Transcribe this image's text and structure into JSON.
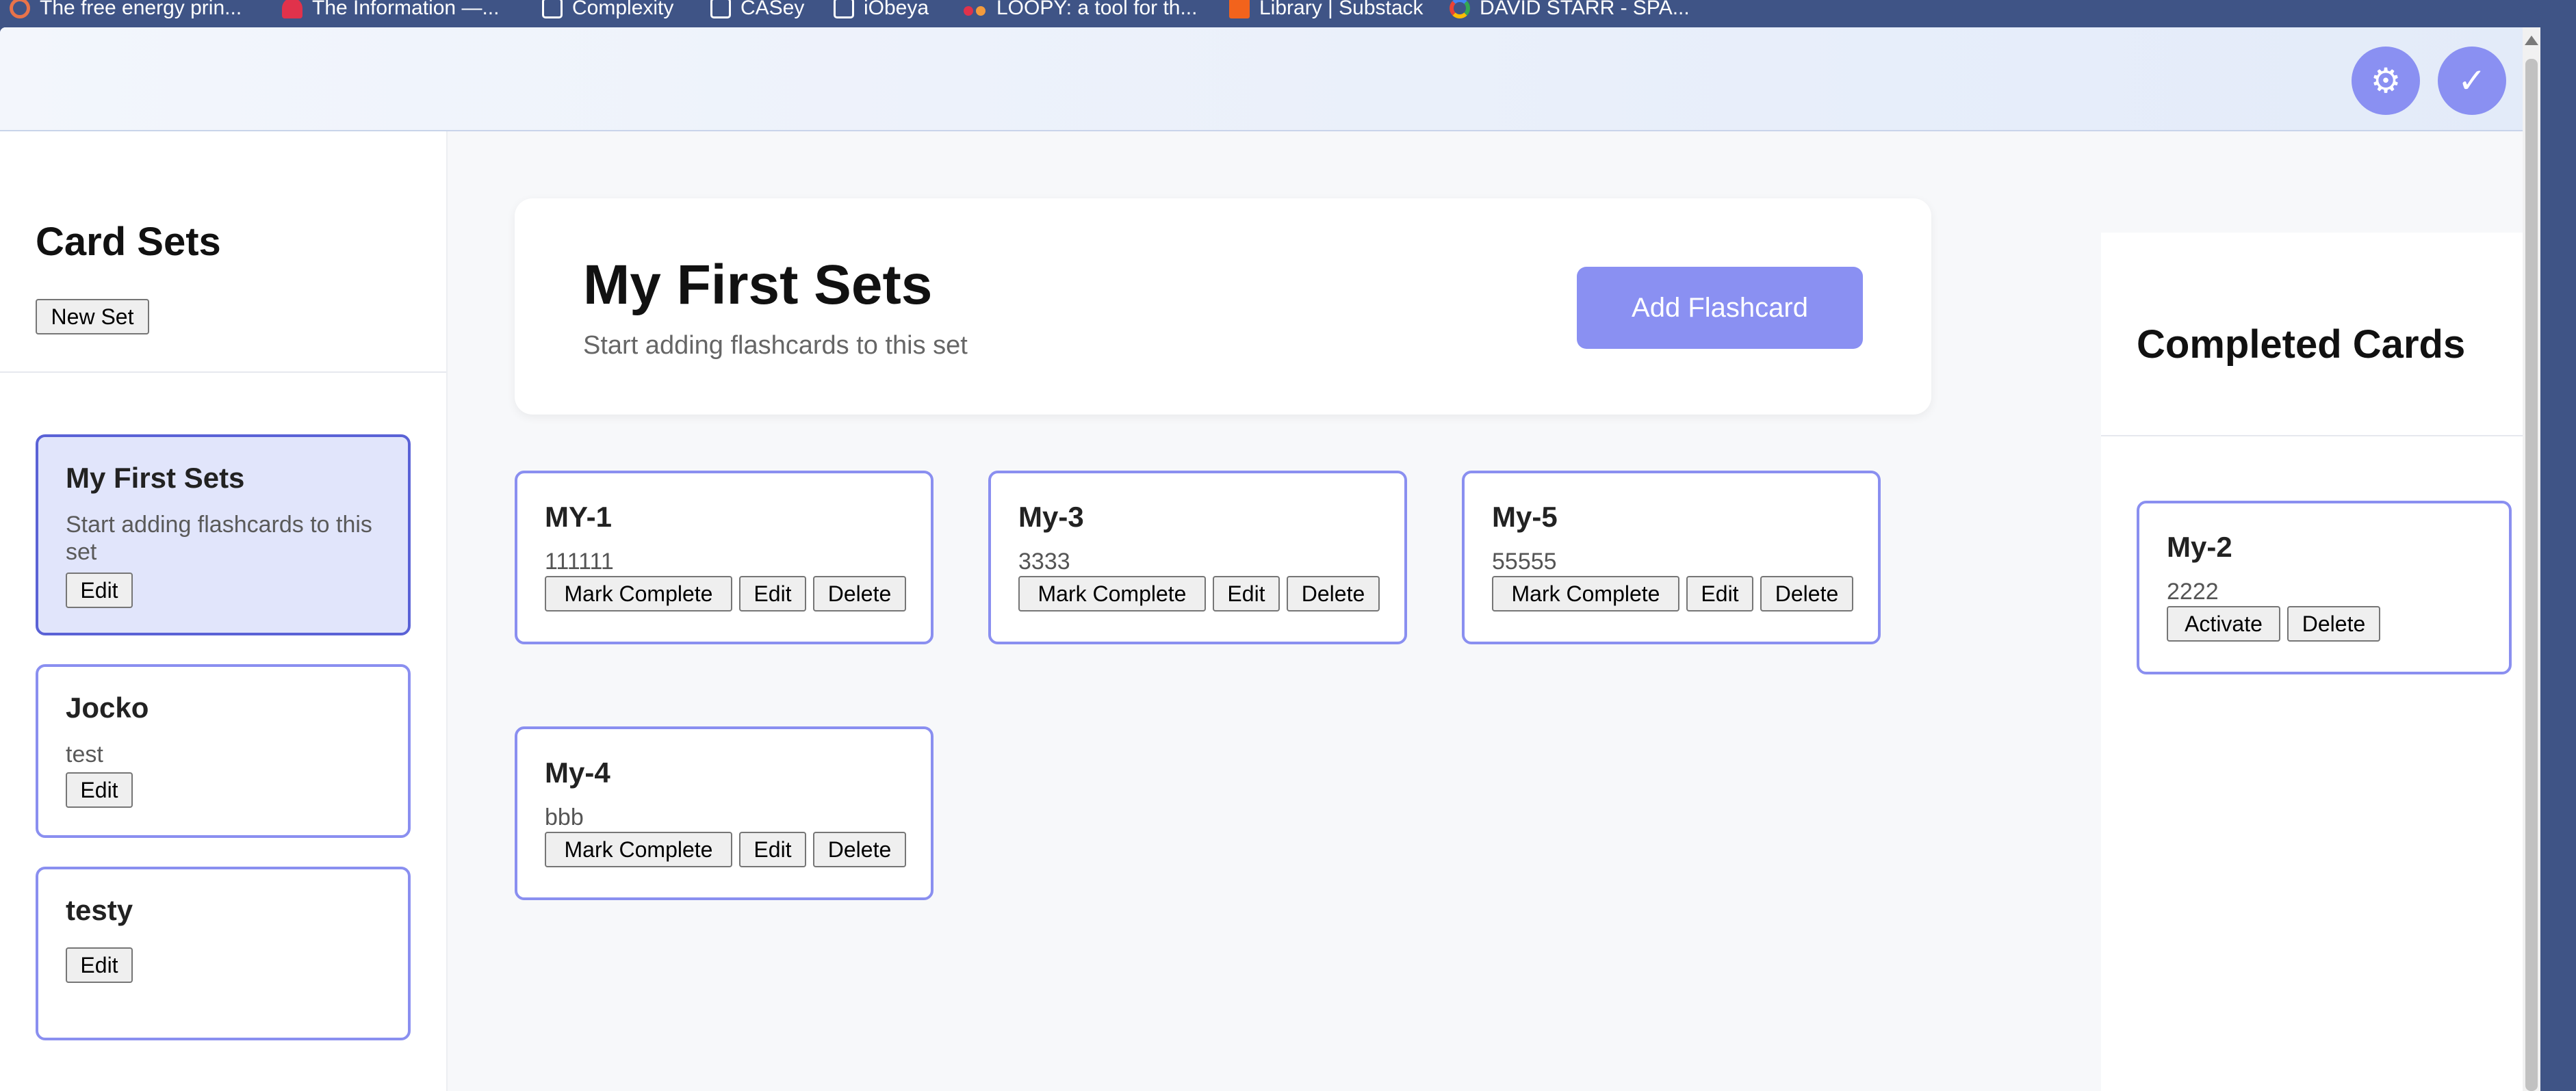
{
  "bookmarks": [
    {
      "label": "The free energy prin...",
      "icon": "circle-icon"
    },
    {
      "label": "The Information —...",
      "icon": "person-icon"
    },
    {
      "label": "Complexity",
      "icon": "folder-icon"
    },
    {
      "label": "CASey",
      "icon": "folder-icon"
    },
    {
      "label": "iObeya",
      "icon": "folder-icon"
    },
    {
      "label": "LOOPY: a tool for th...",
      "icon": "loopy-icon"
    },
    {
      "label": "Library | Substack",
      "icon": "bookmark-icon"
    },
    {
      "label": "DAVID STARR - SPA...",
      "icon": "google-icon"
    }
  ],
  "topbar": {
    "settings_icon": "⚙",
    "check_icon": "✓"
  },
  "sidebar": {
    "title": "Card Sets",
    "new_set_label": "New Set",
    "sets": [
      {
        "name": "My First Sets",
        "description": "Start adding flashcards to this set",
        "edit_label": "Edit",
        "active": true
      },
      {
        "name": "Jocko",
        "description": "test",
        "edit_label": "Edit",
        "active": false
      },
      {
        "name": "testy",
        "description": "",
        "edit_label": "Edit",
        "active": false
      }
    ]
  },
  "main": {
    "set_title": "My First Sets",
    "set_description": "Start adding flashcards to this set",
    "add_label": "Add Flashcard",
    "cards": [
      {
        "title": "MY-1",
        "body": "111111",
        "complete_label": "Mark Complete",
        "edit_label": "Edit",
        "delete_label": "Delete"
      },
      {
        "title": "My-3",
        "body": "3333",
        "complete_label": "Mark Complete",
        "edit_label": "Edit",
        "delete_label": "Delete"
      },
      {
        "title": "My-5",
        "body": "55555",
        "complete_label": "Mark Complete",
        "edit_label": "Edit",
        "delete_label": "Delete"
      },
      {
        "title": "My-4",
        "body": "bbb",
        "complete_label": "Mark Complete",
        "edit_label": "Edit",
        "delete_label": "Delete"
      }
    ]
  },
  "completed": {
    "title": "Completed Cards",
    "cards": [
      {
        "title": "My-2",
        "body": "2222",
        "activate_label": "Activate",
        "delete_label": "Delete"
      }
    ]
  },
  "colors": {
    "accent": "#8a90f2",
    "card_border": "#8a8ff0",
    "active_set_bg": "#e1e5fb",
    "browser_chrome": "#3f5486"
  }
}
